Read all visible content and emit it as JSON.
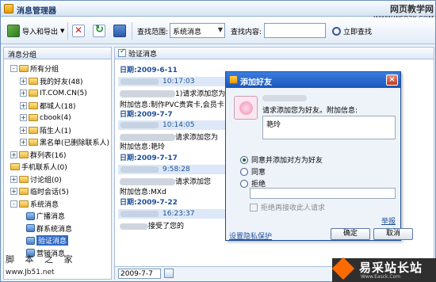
{
  "window": {
    "title": "消息管理器"
  },
  "watermarks": {
    "top_right": "网页教学网",
    "top_right_url": "WWW.WEB3X.COM",
    "bottom_left": "脚 本 之 家",
    "bottom_left_url": "www.Jb51.net",
    "bottom_right": "易采站长站",
    "bottom_right_url": "Www.Easck.Com"
  },
  "toolbar": {
    "import_export": "导入和导出",
    "scope_label": "查找范围:",
    "scope_value": "系统消息",
    "content_label": "查找内容:",
    "content_value": "",
    "search_now": "立即查找"
  },
  "left_panel": {
    "header": "消息分组",
    "tree": [
      {
        "label": "所有分组",
        "expand": "-"
      },
      {
        "label": "我的好友(48)",
        "expand": "+"
      },
      {
        "label": "IT.COM.CN(5)",
        "expand": "+"
      },
      {
        "label": "都城人(18)",
        "expand": "+"
      },
      {
        "label": "cbook(4)",
        "expand": "+"
      },
      {
        "label": "陌生人(1)",
        "expand": "+"
      },
      {
        "label": "黑名单(已删除联系人)",
        "expand": "+"
      },
      {
        "label": "群列表(16)",
        "expand": "+"
      },
      {
        "label": "手机联系人(0)",
        "expand": ""
      },
      {
        "label": "讨论组(0)",
        "expand": "+"
      },
      {
        "label": "临时会话(5)",
        "expand": "+"
      },
      {
        "label": "系统消息",
        "expand": "-"
      },
      {
        "label": "广播消息",
        "expand": ""
      },
      {
        "label": "群系统消息",
        "expand": ""
      },
      {
        "label": "验证消息",
        "expand": ""
      },
      {
        "label": "营销消息",
        "expand": ""
      }
    ]
  },
  "right_panel": {
    "tab": "验证消息",
    "messages": [
      {
        "date": "日期:2009-6-11",
        "time": "10:17:03",
        "line1_suffix": "1)请求添加您为好友。",
        "line2": "附加信息:制作PVC贵宾卡,会员卡"
      },
      {
        "date": "日期:2009-7-7",
        "time": "10:14:05",
        "line1_suffix": "请求添加您为",
        "line2": "附加信息:艳玲"
      },
      {
        "date": "日期:2009-7-17",
        "time": "9:58:28",
        "line1_suffix": "请求添加您",
        "line2": "附加信息:MXd"
      },
      {
        "date": "日期:2009-7-22",
        "time": "16:23:37",
        "line1_suffix": "接受了您的"
      }
    ],
    "footer_date": "2009-7-7"
  },
  "dialog": {
    "title": "添加好友",
    "close": "×",
    "request_text": "请求添加您为好友。附加信息:",
    "note": "艳玲",
    "options": [
      "同意并添加对方为好友",
      "同意",
      "拒绝"
    ],
    "no_more_requests": "拒绝再接收此人请求",
    "report": "举报",
    "privacy": "设置隐私保护",
    "ok": "确定",
    "cancel": "取消"
  }
}
